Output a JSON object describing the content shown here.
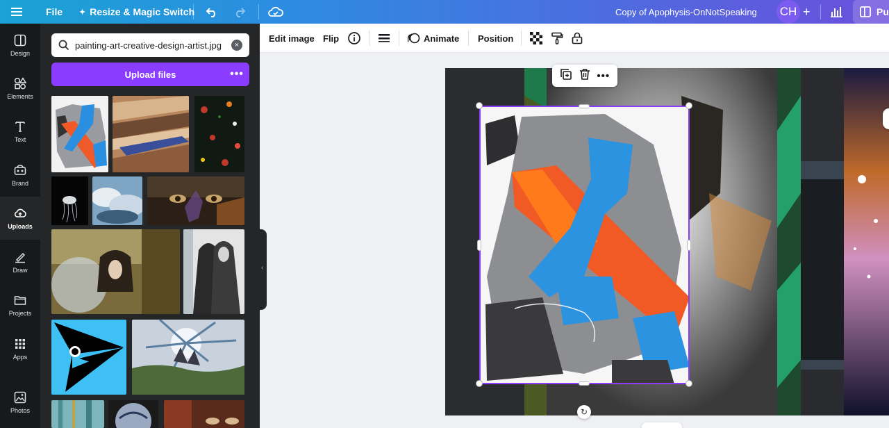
{
  "topbar": {
    "file_label": "File",
    "resize_label": "Resize & Magic Switch",
    "title": "Copy of Apophysis-OnNotSpeaking",
    "avatar_initials": "CH",
    "publish_label": "Pu"
  },
  "rail": {
    "items": [
      {
        "label": "Design",
        "icon": "design-icon"
      },
      {
        "label": "Elements",
        "icon": "elements-icon"
      },
      {
        "label": "Text",
        "icon": "text-icon"
      },
      {
        "label": "Brand",
        "icon": "brand-icon"
      },
      {
        "label": "Uploads",
        "icon": "cloud-upload-icon"
      },
      {
        "label": "Draw",
        "icon": "pen-icon"
      },
      {
        "label": "Projects",
        "icon": "folder-icon"
      },
      {
        "label": "Apps",
        "icon": "apps-grid-icon"
      },
      {
        "label": "Photos",
        "icon": "image-icon"
      }
    ],
    "active": "Uploads"
  },
  "panel": {
    "search_value": "painting-art-creative-design-artist.jpg",
    "upload_label": "Upload files",
    "more_label": "•••"
  },
  "toolbar": {
    "edit_image_label": "Edit image",
    "flip_label": "Flip",
    "animate_label": "Animate",
    "position_label": "Position"
  },
  "colors": {
    "accent": "#8b3dff",
    "panel_bg": "#252627",
    "rail_bg": "#18191b"
  }
}
